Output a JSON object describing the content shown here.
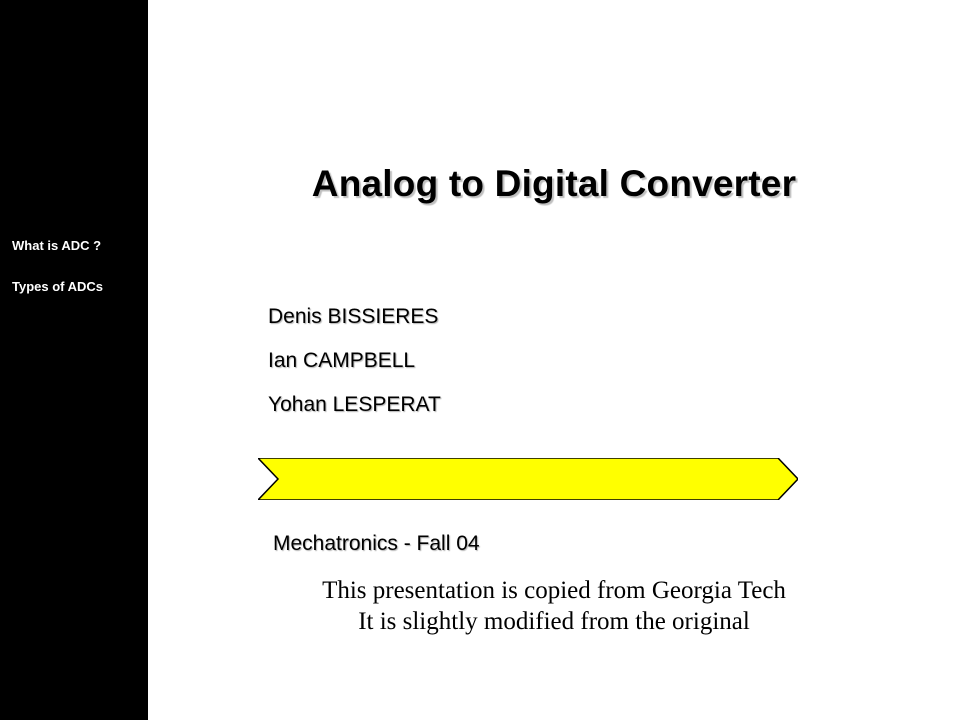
{
  "sidebar": {
    "items": [
      {
        "label": "What is ADC ?"
      },
      {
        "label": "Types of ADCs"
      }
    ]
  },
  "slide": {
    "title": "Analog to Digital Converter",
    "authors": [
      "Denis BISSIERES",
      "Ian CAMPBELL",
      "Yohan LESPERAT"
    ],
    "course": "Mechatronics - Fall 04",
    "note_line1": "This presentation is copied from Georgia Tech",
    "note_line2": "It is slightly modified from the original"
  },
  "shapes": {
    "arrow_fill": "#ffff00",
    "arrow_stroke": "#000000"
  }
}
